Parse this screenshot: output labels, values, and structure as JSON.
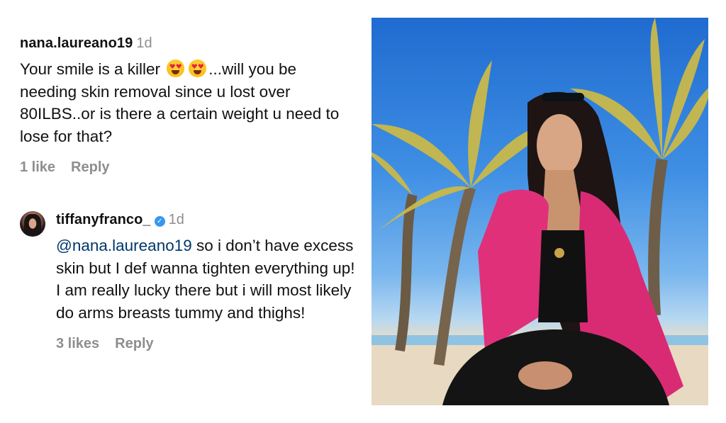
{
  "comment1": {
    "username": "nana.laureano19",
    "age": "1d",
    "text_before": "Your smile is a killer",
    "text_after": "...will you be needing skin removal since u lost over 80ILBS..or is there a certain weight u need to lose for that?",
    "emojis": [
      "heart-eyes-emoji",
      "heart-eyes-emoji"
    ],
    "likes": "1 like",
    "reply": "Reply"
  },
  "comment2": {
    "username": "tiffanyfranco_",
    "age": "1d",
    "mention": "@nana.laureano19",
    "text": " so i don’t have excess skin but I def wanna tighten everything up! I am really lucky there but i will most likely do arms breasts tummy and thighs!",
    "likes": "3 likes",
    "reply": "Reply"
  },
  "photo": {
    "subject": "photo-beach-palms",
    "colors": {
      "sky": "#3f8fe4",
      "jacket": "#e0307a",
      "sand": "#e6d6bd"
    }
  }
}
